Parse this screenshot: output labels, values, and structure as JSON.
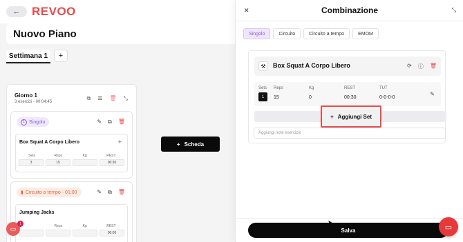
{
  "app": {
    "logo": "REVOO",
    "back_icon": "arrow-left-icon"
  },
  "plan": {
    "title": "Nuovo Piano",
    "week_tab": "Settimana 1",
    "add_week": "+"
  },
  "day": {
    "title": "Giorno 1",
    "subtitle": "3 esercizi - 00:04:45",
    "blocks": [
      {
        "type_label": "Singolo",
        "type_number": "1",
        "exercise": "Box Squat A Corpo Libero",
        "headers": [
          "Sets",
          "Reps",
          "Kg",
          "REST"
        ],
        "values": [
          "3",
          "15",
          "",
          "00:30"
        ]
      },
      {
        "type_label": "Circuito a tempo - 01:00",
        "exercise": "Jumping Jacks",
        "headers": [
          "",
          "Reps",
          "Kg",
          "REST"
        ],
        "values": [
          "",
          "",
          "",
          "00:00"
        ]
      }
    ]
  },
  "scheda_button": "Scheda",
  "chat_badge": "1",
  "drawer": {
    "title": "Combinazione",
    "tabs": [
      "Singolo",
      "Circuito",
      "Circuito a tempo",
      "EMOM"
    ],
    "active_tab": "Singolo",
    "exercise": {
      "name": "Box Squat A Corpo Libero",
      "columns": [
        "Sets",
        "Reps",
        "Kg",
        "REST",
        "TUT"
      ],
      "set_number": "1",
      "values": {
        "reps": "15",
        "kg": "0",
        "rest": "00:30",
        "tut": "0-0-0-0"
      }
    },
    "add_set": "Aggiungi Set",
    "notes_placeholder": "Aggiungi note esercizio",
    "save": "Salva"
  },
  "colors": {
    "brand": "#e94b4b",
    "purple": "#8b5cd6",
    "dark": "#0a0a0a"
  }
}
